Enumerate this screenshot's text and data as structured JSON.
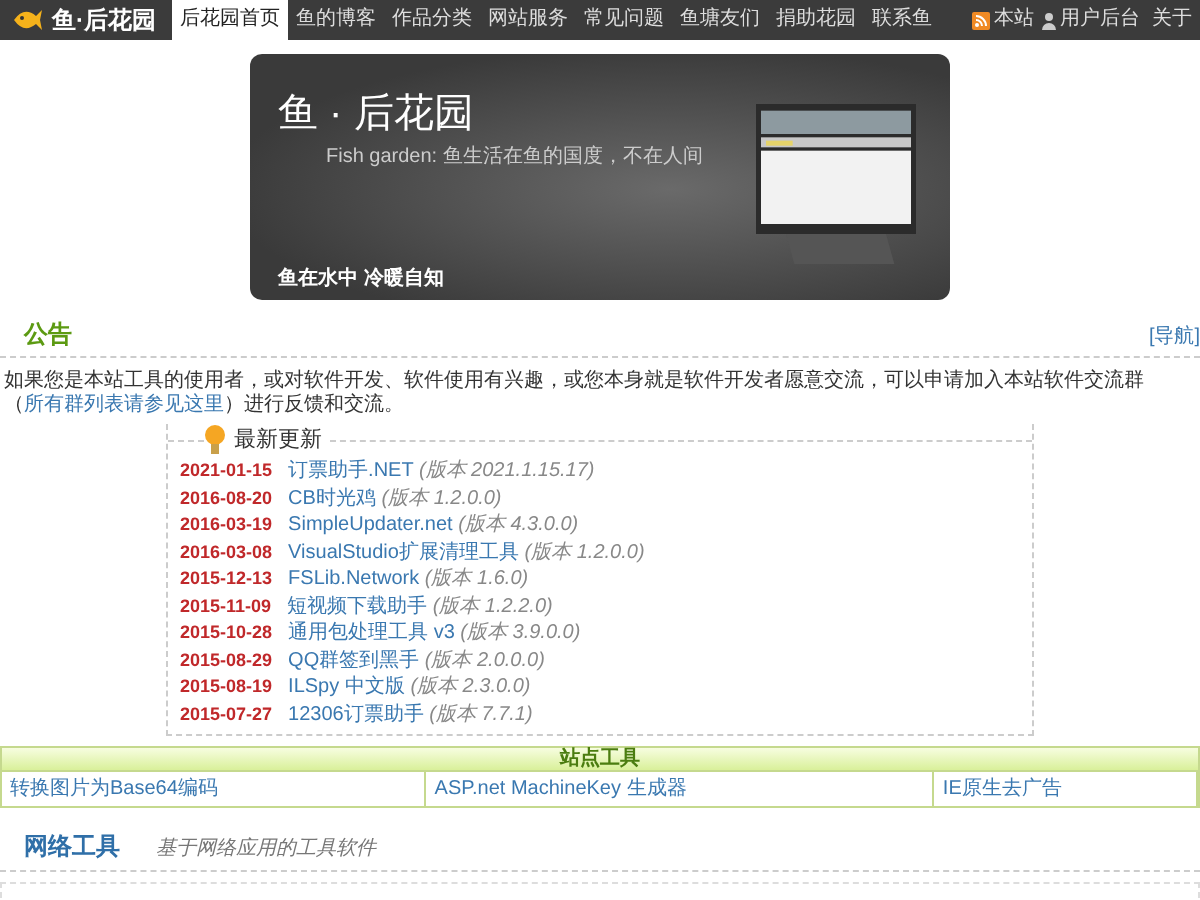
{
  "navbar": {
    "logo": "鱼·后花园",
    "items": [
      {
        "label": "后花园首页",
        "selected": true
      },
      {
        "label": "鱼的博客",
        "selected": false
      },
      {
        "label": "作品分类",
        "selected": false
      },
      {
        "label": "网站服务",
        "selected": false
      },
      {
        "label": "常见问题",
        "selected": false
      },
      {
        "label": "鱼塘友们",
        "selected": false
      },
      {
        "label": "捐助花园",
        "selected": false
      },
      {
        "label": "联系鱼",
        "selected": false
      }
    ],
    "right_items": [
      {
        "kind": "rss",
        "label": "本站"
      },
      {
        "kind": "user",
        "label": "用户后台"
      },
      {
        "kind": "plain",
        "label": "关于"
      }
    ]
  },
  "banner": {
    "title": "鱼 · 后花园",
    "subtitle": "Fish garden: 鱼生活在鱼的国度，不在人间",
    "motto": "鱼在水中 冷暖自知"
  },
  "notice": {
    "title": "公告",
    "nav_link": "[导航]",
    "text_before": "如果您是本站工具的使用者，或对软件开发、软件使用有兴趣，或您本身就是软件开发者愿意交流，可以申请加入本站软件交流群（",
    "link": "所有群列表请参见这里",
    "text_after": "）进行反馈和交流。"
  },
  "updates": {
    "title": "最新更新",
    "items": [
      {
        "date": "2021-01-15",
        "name": "订票助手.NET",
        "version": "(版本 2021.1.15.17)"
      },
      {
        "date": "2016-08-20",
        "name": "CB时光鸡",
        "version": "(版本 1.2.0.0)"
      },
      {
        "date": "2016-03-19",
        "name": "SimpleUpdater.net",
        "version": "(版本 4.3.0.0)"
      },
      {
        "date": "2016-03-08",
        "name": "VisualStudio扩展清理工具",
        "version": "(版本 1.2.0.0)"
      },
      {
        "date": "2015-12-13",
        "name": "FSLib.Network",
        "version": "(版本 1.6.0)"
      },
      {
        "date": "2015-11-09",
        "name": "短视频下载助手",
        "version": "(版本 1.2.2.0)"
      },
      {
        "date": "2015-10-28",
        "name": "通用包处理工具 v3",
        "version": "(版本 3.9.0.0)"
      },
      {
        "date": "2015-08-29",
        "name": "QQ群签到黑手",
        "version": "(版本 2.0.0.0)"
      },
      {
        "date": "2015-08-19",
        "name": "ILSpy 中文版",
        "version": "(版本 2.3.0.0)"
      },
      {
        "date": "2015-07-27",
        "name": "12306订票助手",
        "version": "(版本 7.7.1)"
      }
    ]
  },
  "site_tools": {
    "title": "站点工具",
    "links": [
      "转换图片为Base64编码",
      "ASP.net MachineKey 生成器",
      "IE原生去广告"
    ]
  },
  "network_tools": {
    "title": "网络工具",
    "subtitle": "基于网络应用的工具软件"
  }
}
